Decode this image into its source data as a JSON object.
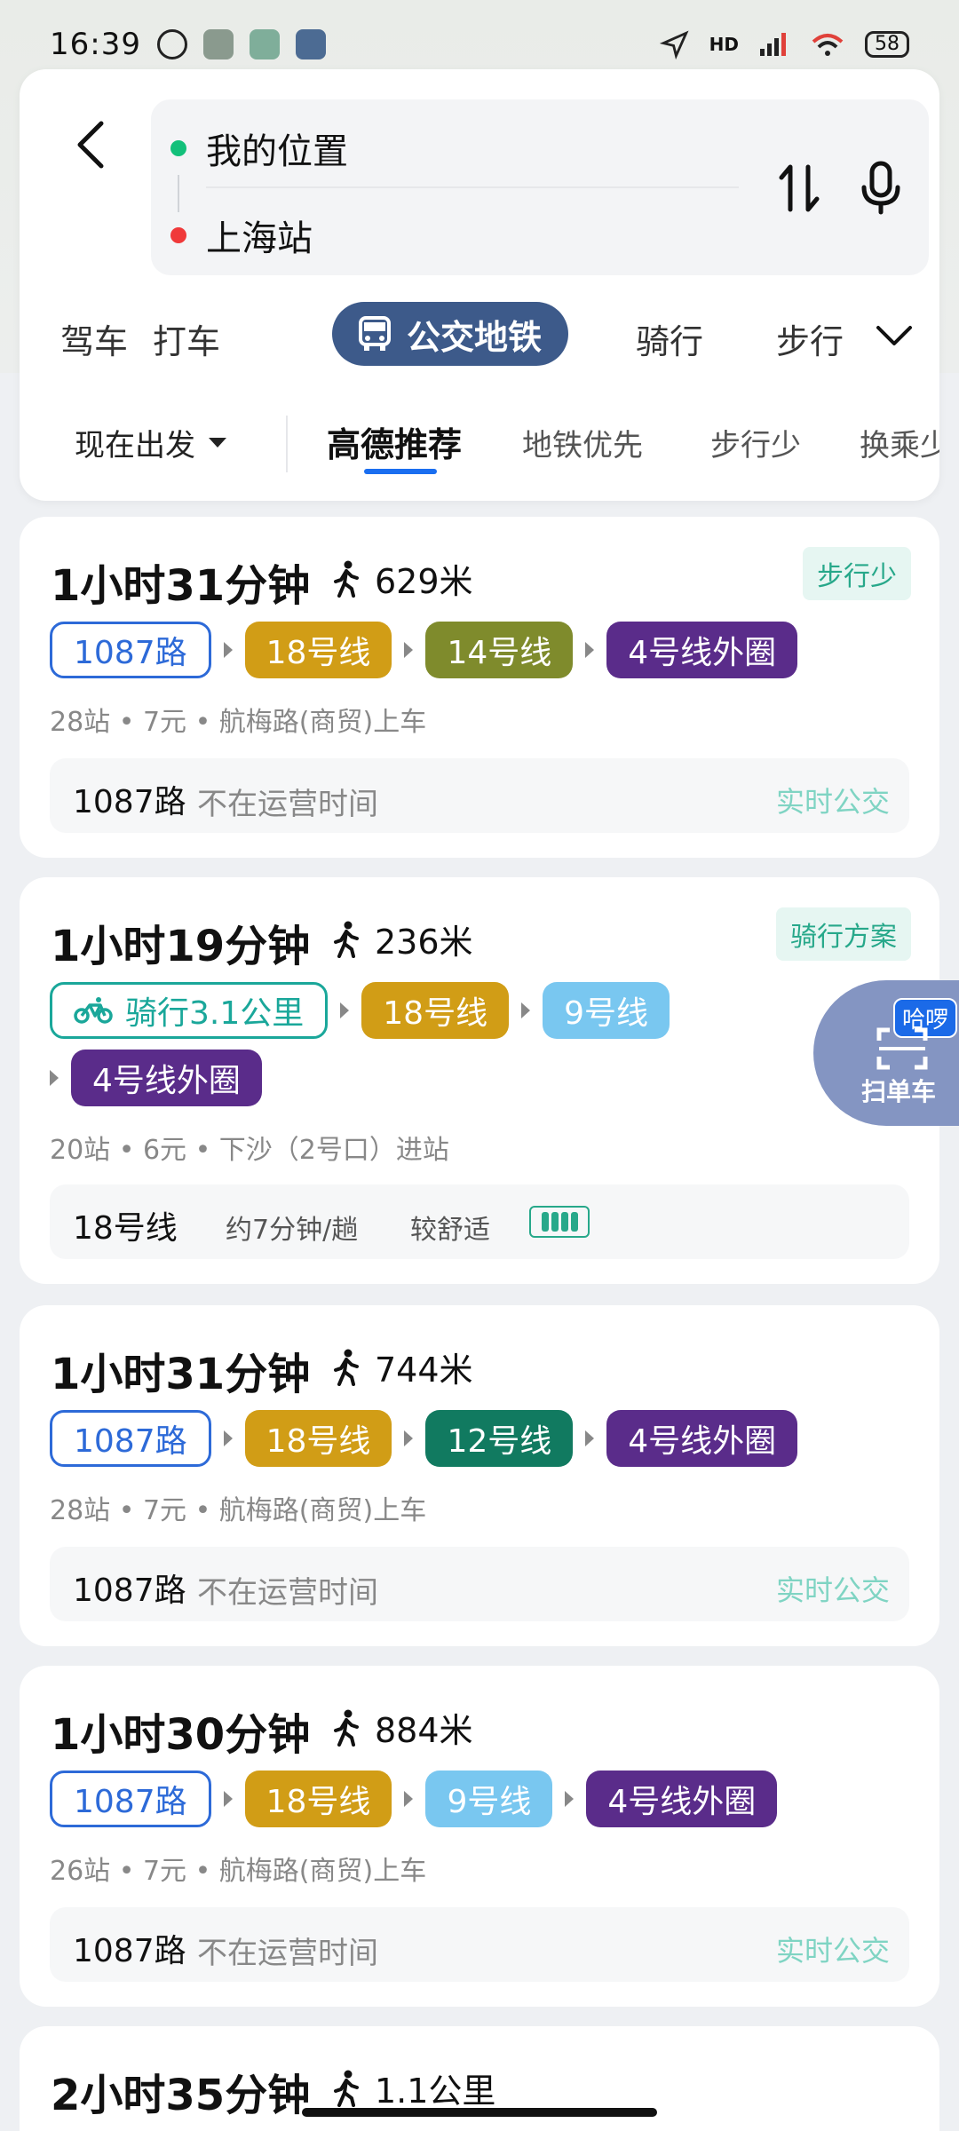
{
  "status_bar": {
    "time": "16:39",
    "network": "HD",
    "battery": "58"
  },
  "search": {
    "from": "我的位置",
    "to": "上海站"
  },
  "mode_tabs": [
    "驾车",
    "打车",
    "公交地铁",
    "骑行",
    "步行"
  ],
  "filters": {
    "depart": "现在出发",
    "options": [
      "高德推荐",
      "地铁优先",
      "步行少",
      "换乘少"
    ]
  },
  "routes": [
    {
      "duration": "1小时31分钟",
      "walk": "629米",
      "tag": "步行少",
      "segments": [
        "1087路",
        "18号线",
        "14号线",
        "4号线外圈"
      ],
      "meta": "28站 • 7元 • 航梅路(商贸)上车",
      "status_line": "1087路",
      "status_note": "不在运营时间",
      "status_live": "实时公交"
    },
    {
      "duration": "1小时19分钟",
      "walk": "236米",
      "tag": "骑行方案",
      "segments": [
        "骑行3.1公里",
        "18号线",
        "9号线",
        "4号线外圈"
      ],
      "meta": "20站 • 6元 • 下沙（2号口）进站",
      "status_line": "18号线",
      "frequency": "约7分钟/趟",
      "comfort": "较舒适"
    },
    {
      "duration": "1小时31分钟",
      "walk": "744米",
      "segments": [
        "1087路",
        "18号线",
        "12号线",
        "4号线外圈"
      ],
      "meta": "28站 • 7元 • 航梅路(商贸)上车",
      "status_line": "1087路",
      "status_note": "不在运营时间",
      "status_live": "实时公交"
    },
    {
      "duration": "1小时30分钟",
      "walk": "884米",
      "segments": [
        "1087路",
        "18号线",
        "9号线",
        "4号线外圈"
      ],
      "meta": "26站 • 7元 • 航梅路(商贸)上车",
      "status_line": "1087路",
      "status_note": "不在运营时间",
      "status_live": "实时公交"
    },
    {
      "duration": "2小时35分钟",
      "walk": "1.1公里"
    }
  ],
  "scan_button": {
    "badge": "哈啰",
    "label": "扫单车"
  },
  "colors": {
    "primary_tab": "#3d5a8a",
    "bus": "#2d6ad8",
    "bike": "#1aa79a",
    "line18": "#d19d16",
    "line14": "#7f8b2c",
    "line12": "#117a60",
    "line9": "#79c7f0",
    "line4": "#5a2c8a"
  }
}
